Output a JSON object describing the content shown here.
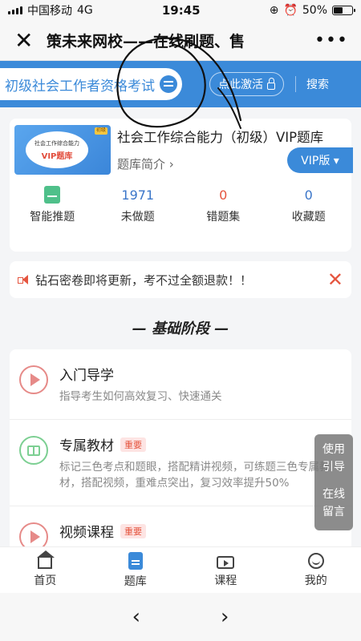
{
  "status_bar": {
    "carrier": "中国移动",
    "network": "4G",
    "time": "19:45",
    "battery": "50%",
    "battery_level": 0.5
  },
  "nav": {
    "close_glyph": "✕",
    "title": "策未来网校——在线刷题、售",
    "more_glyph": "•••"
  },
  "banner": {
    "exam_name": "初级社会工作者资格考试",
    "activate_label": "点此激活",
    "search_label": "搜索",
    "color": "#3b8ad9"
  },
  "product": {
    "cover_line1": "社会工作综合能力",
    "cover_line2": "VIP题库",
    "cover_tag": "初级",
    "title": "社会工作综合能力（初级）VIP题库",
    "intro_label": "题库简介 ›",
    "vip_label": "VIP版 ▾",
    "stats": [
      {
        "label": "智能推题"
      },
      {
        "value": "1971",
        "label": "未做题"
      },
      {
        "value": "0",
        "label": "错题集"
      },
      {
        "value": "0",
        "label": "收藏题"
      }
    ]
  },
  "notice": {
    "text": "钻石密卷即将更新，考不过全额退款！！",
    "close_glyph": "✕"
  },
  "section": {
    "title": "— 基础阶段 —"
  },
  "lessons": [
    {
      "title": "入门导学",
      "desc": "指导考生如何高效复习、快速通关",
      "icon": "play-icon"
    },
    {
      "title": "专属教材",
      "badge": "重要",
      "desc": "标记三色考点和题眼，搭配精讲视频，可练题三色专属教材，搭配视频，重难点突出，复习效率提升50%",
      "icon": "book-icon"
    },
    {
      "title": "视频课程",
      "badge": "重要",
      "desc": "",
      "icon": "play-icon"
    }
  ],
  "float_help": {
    "line1": "使用",
    "line2": "引导",
    "line3": "在线",
    "line4": "留言"
  },
  "tabs": [
    {
      "label": "首页",
      "icon": "home-icon"
    },
    {
      "label": "题库",
      "icon": "question-bank-icon"
    },
    {
      "label": "课程",
      "icon": "course-icon"
    },
    {
      "label": "我的",
      "icon": "profile-icon"
    }
  ],
  "browser_nav": {
    "back_glyph": "‹",
    "forward_glyph": "›"
  }
}
